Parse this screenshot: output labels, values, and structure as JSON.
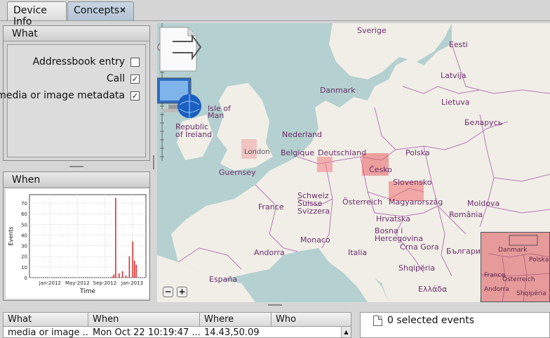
{
  "tabs": [
    {
      "label": "Device Info"
    },
    {
      "label": "Concepts",
      "close": "×"
    }
  ],
  "what": {
    "title": "What",
    "items": [
      {
        "label": "Addressbook entry",
        "checked": ""
      },
      {
        "label": "Call",
        "checked": "✓"
      },
      {
        "label": "media or image metadata",
        "checked": "✓"
      }
    ]
  },
  "when": {
    "title": "When"
  },
  "chart_data": {
    "type": "bar",
    "ylabel": "Events",
    "xlabel": "Time",
    "yticks": [
      0,
      10,
      20,
      30,
      40,
      50,
      60,
      70
    ],
    "ylim": [
      0,
      78
    ],
    "xticks": [
      "Jan-2012",
      "May-2012",
      "Sep-2012",
      "Jan-2013"
    ],
    "x_range": [
      "Oct-2011",
      "Mar-2013"
    ],
    "grid": true,
    "color": "#e03030",
    "values": [
      {
        "x": "Oct-2012 w1",
        "y": 1
      },
      {
        "x": "Oct-2012 w2",
        "y": 3
      },
      {
        "x": "Oct-2012 w3",
        "y": 75
      },
      {
        "x": "Nov-2012 w1",
        "y": 4
      },
      {
        "x": "Nov-2012 w3",
        "y": 6
      },
      {
        "x": "Dec-2012 w1",
        "y": 2
      },
      {
        "x": "Dec-2012 w3",
        "y": 20
      },
      {
        "x": "Jan-2013 w1",
        "y": 34
      },
      {
        "x": "Jan-2013 w2",
        "y": 16
      },
      {
        "x": "Jan-2013 w3",
        "y": 12
      }
    ]
  },
  "map": {
    "seas": [
      {
        "text": "Sverige"
      },
      {
        "text": "Eesti"
      },
      {
        "text": "Latvija"
      },
      {
        "text": "Lietuva"
      },
      {
        "text": "Danmark"
      },
      {
        "text": "Беларусь"
      },
      {
        "text": "Isle of Man"
      },
      {
        "text": "Republic of Ireland"
      },
      {
        "text": "Nederland"
      },
      {
        "text": "Deutschland"
      },
      {
        "text": "Polska"
      },
      {
        "text": "Belgique"
      },
      {
        "text": "Česko"
      },
      {
        "text": "Slovensko"
      },
      {
        "text": "Magyarország"
      },
      {
        "text": "Österreich"
      },
      {
        "text": "Schweiz Suisse Svizzera"
      },
      {
        "text": "France"
      },
      {
        "text": "Guernsey"
      },
      {
        "text": "London"
      },
      {
        "text": "Hrvatska"
      },
      {
        "text": "Bosna i Hercegovina"
      },
      {
        "text": "Crna Gora"
      },
      {
        "text": "Shqipëria"
      },
      {
        "text": "Monaco"
      },
      {
        "text": "Andorra"
      },
      {
        "text": "España"
      },
      {
        "text": "Italia"
      },
      {
        "text": "România"
      },
      {
        "text": "Moldova"
      },
      {
        "text": "България"
      },
      {
        "text": "Ελλάδα"
      }
    ],
    "minimap_labels": [
      {
        "text": "Danmark"
      },
      {
        "text": "Polska"
      },
      {
        "text": "France"
      },
      {
        "text": "Österreich"
      },
      {
        "text": "Andorra"
      },
      {
        "text": "Shqipëria"
      }
    ],
    "zoom_in": "+",
    "zoom_out": "−"
  },
  "table": {
    "headers": [
      "What",
      "When",
      "Where",
      "Who"
    ],
    "rows": [
      [
        "media or image ...",
        "Mon Oct 22 10:19:47 ...",
        "14.43,50.09",
        ""
      ]
    ]
  },
  "selection": {
    "text": "0 selected events"
  }
}
